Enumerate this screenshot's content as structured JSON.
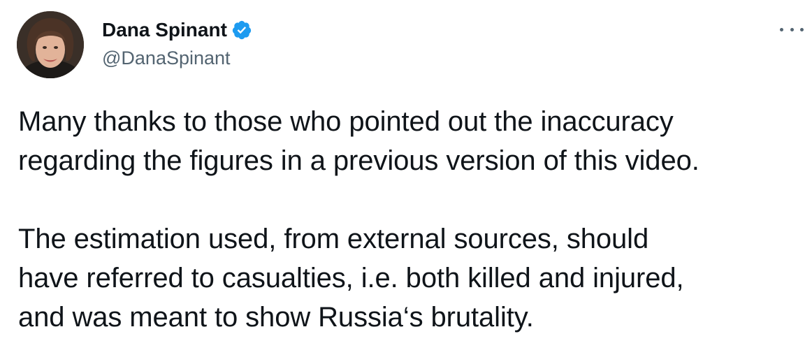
{
  "author": {
    "display_name": "Dana Spinant",
    "handle": "@DanaSpinant",
    "verified": true,
    "avatar_icon": "profile-photo"
  },
  "menu": {
    "icon": "more-horizontal-icon"
  },
  "tweet": {
    "paragraph_1": [
      "Many thanks to those who pointed out the inaccuracy",
      "regarding the figures in a previous version of this video."
    ],
    "paragraph_2": [
      "The estimation used, from external sources, should",
      "have referred to casualties, i.e. both killed and injured,",
      "and was meant to show Russia‘s brutality."
    ]
  },
  "colors": {
    "text_primary": "#0f1419",
    "text_secondary": "#536471",
    "verified_blue": "#1d9bf0"
  }
}
